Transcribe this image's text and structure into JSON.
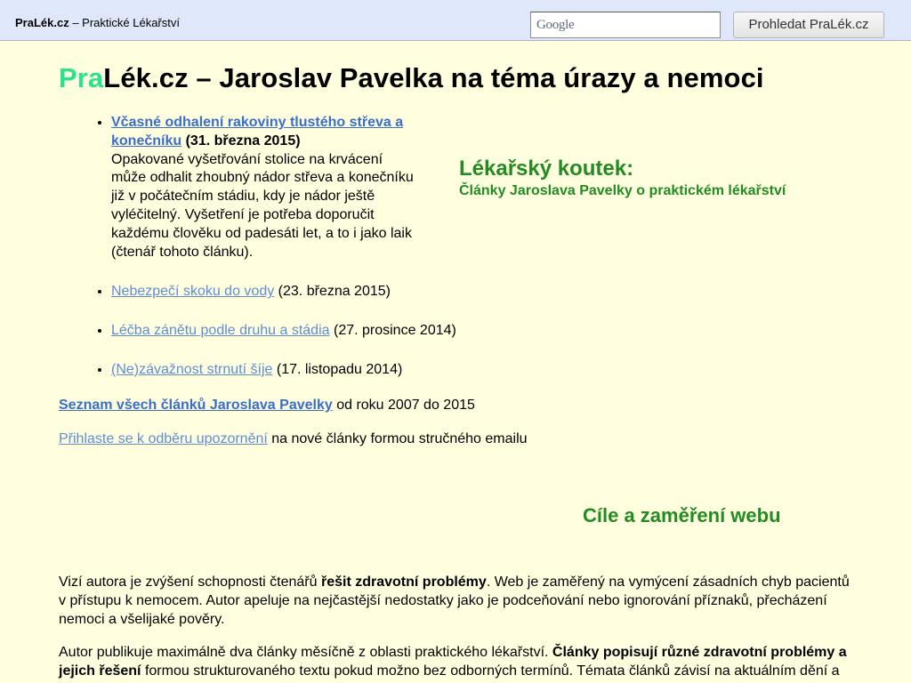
{
  "topbar": {
    "brand_name": "PraLék.cz",
    "brand_tagline": "– Praktické Lékařství",
    "search_logo": "Google",
    "search_button": "Prohledat PraLék.cz"
  },
  "title": {
    "prefix": "Pra",
    "rest": "Lék.cz – Jaroslav Pavelka na téma úrazy a nemoci"
  },
  "articles": [
    {
      "link": "Včasné odhalení rakoviny tlustého střeva a konečníku",
      "date": "(31. března 2015)",
      "description": "Opakované vyšetřování stolice na krvácení může odhalit zhoubný nádor střeva a konečníku již v počátečním stádiu, kdy je nádor ještě vyléčitelný. Vyšetření je potřeba doporučit každému člověku od padesáti let, a to i jako laik (čtenář tohoto článku)."
    },
    {
      "link": "Nebezpečí skoku do vody",
      "date": "(23. března 2015)"
    },
    {
      "link": "Léčba zánětu podle druhu a stádia",
      "date": "(27. prosince 2014)"
    },
    {
      "link": "(Ne)závažnost strnutí šíje",
      "date": "(17. listopadu 2014)"
    }
  ],
  "corner": {
    "heading": "Lékařský koutek:",
    "subheading": "Články Jaroslava Pavelky o praktickém lékařství"
  },
  "all_articles": {
    "link": "Seznam všech článků Jaroslava Pavelky",
    "text": "od roku 2007 do 2015"
  },
  "subscribe": {
    "link": "Přihlaste se k odběru upozornění",
    "text": "na nové články formou stručného emailu"
  },
  "goals": {
    "heading": "Cíle a zaměření webu",
    "p1_a": "Vizí autora je zvýšení schopnosti čtenářů ",
    "p1_b": "řešit zdravotní problémy",
    "p1_c": ". Web je zaměřený na vymýcení zásadních chyb pacientů v přístupu k nemocem. Autor apeluje na nejčastější nedostatky jako je podceňování nebo ignorování příznaků, přecházení nemoci a všelijaké pověry.",
    "p2_a": "Autor publikuje maximálně dva články měsíčně z oblasti praktického lékařství. ",
    "p2_b": "Články popisují různé zdravotní problémy a jejich řešení",
    "p2_c": " formou strukturovaného textu pokud možno bez odborných termínů. Témata článků závisí na aktuálním dění a"
  }
}
